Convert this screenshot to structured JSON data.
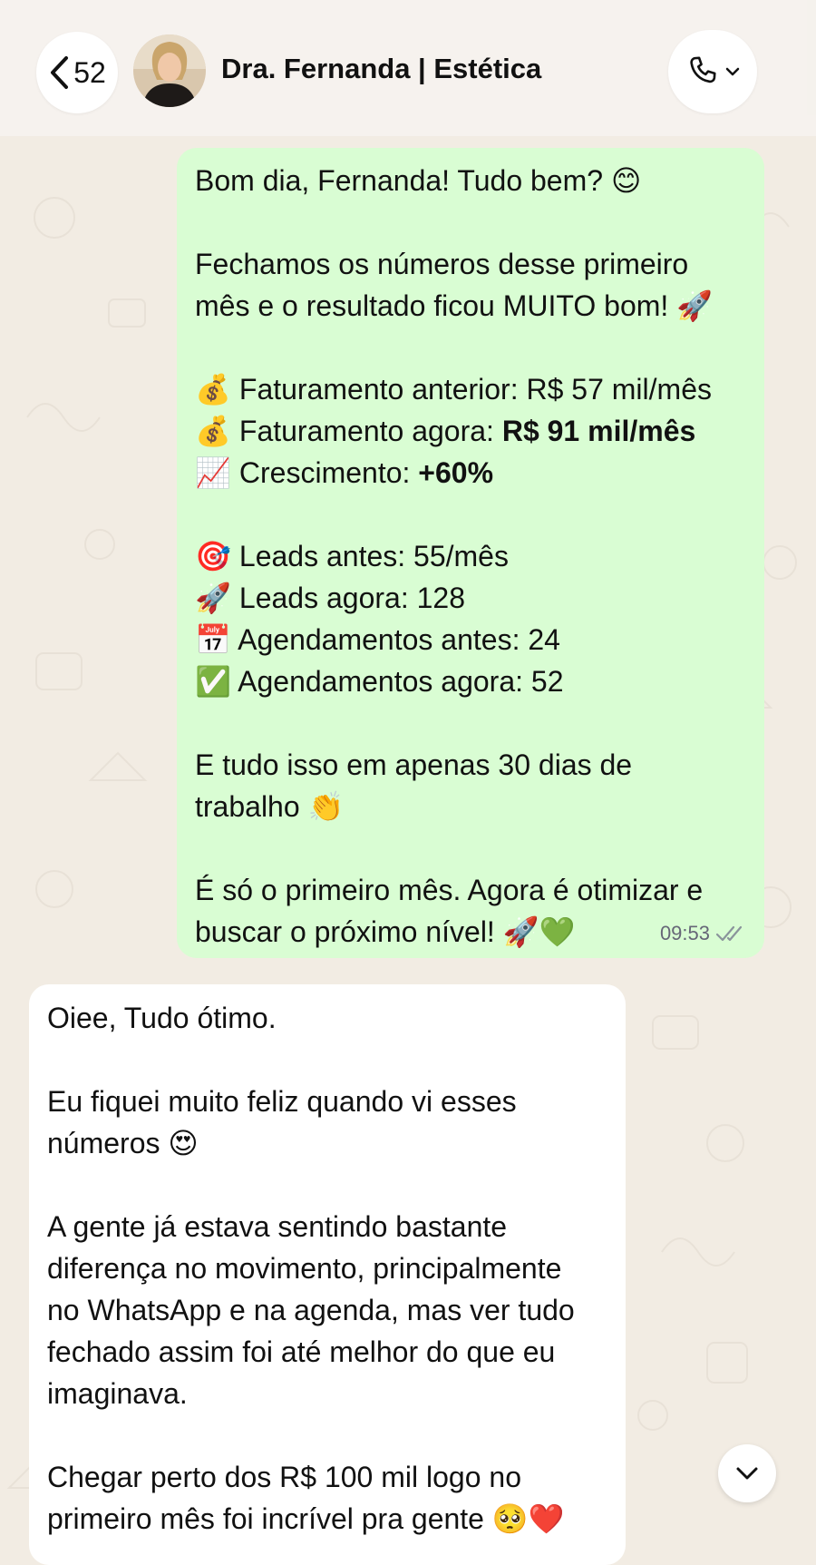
{
  "header": {
    "back_count": "52",
    "contact_name": "Dra. Fernanda | Estética"
  },
  "messages": {
    "outgoing": {
      "greeting": "Bom dia, Fernanda! Tudo bem? 😊",
      "intro_1": "Fechamos os números desse primeiro",
      "intro_2": "mês e o resultado ficou MUITO bom! 🚀",
      "revenue_before_emoji": "💰",
      "revenue_before": "Faturamento anterior: R$ 57 mil/mês",
      "revenue_now_emoji": "💰",
      "revenue_now_label": "Faturamento agora: ",
      "revenue_now_value": "R$ 91 mil/mês",
      "growth_emoji": "📈",
      "growth_label": "Crescimento: ",
      "growth_value": "+60%",
      "leads_before_emoji": "🎯",
      "leads_before": "Leads antes: 55/mês",
      "leads_now_emoji": "🚀",
      "leads_now": "Leads agora: 128",
      "appointments_before_emoji": "📅",
      "appointments_before": "Agendamentos antes: 24",
      "appointments_now_emoji": "✅",
      "appointments_now": "Agendamentos agora: 52",
      "summary_1": "E tudo isso em apenas 30 dias de",
      "summary_2": "trabalho 👏",
      "closing_1": "É só o primeiro mês. Agora é otimizar e",
      "closing_2": "buscar o próximo nível! 🚀💚",
      "time": "09:53"
    },
    "incoming": {
      "line_1": "Oiee, Tudo ótimo.",
      "line_2": "Eu fiquei muito feliz quando vi esses",
      "line_3": "números 😍",
      "line_4": "A gente já estava sentindo bastante",
      "line_5": "diferença no movimento, principalmente",
      "line_6": "no WhatsApp e na agenda, mas ver tudo",
      "line_7": "fechado assim foi até melhor do que eu",
      "line_8": "imaginava.",
      "line_9": "Chegar perto dos R$ 100 mil logo no",
      "line_10": "primeiro mês foi incrível pra gente 🥺❤️"
    }
  },
  "colors": {
    "wallpaper": "#f2ece3",
    "outgoing_bubble": "#d9fdd3",
    "incoming_bubble": "#ffffff",
    "read_ticks": "#8a949b"
  }
}
